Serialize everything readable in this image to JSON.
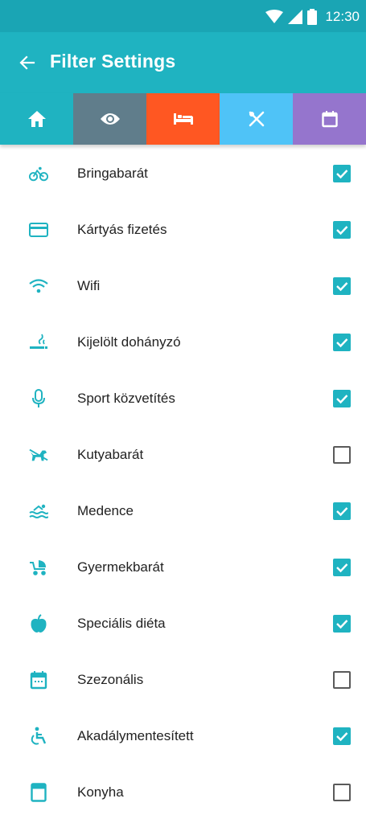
{
  "status_bar": {
    "time": "12:30"
  },
  "app_bar": {
    "title": "Filter Settings"
  },
  "colors": {
    "status": "#1aa5b4",
    "app_bar": "#1fb3c1",
    "accent": "#1fb3c1",
    "tab_home": "#1fb3c1",
    "tab_sights": "#607d8b",
    "tab_accommodation": "#ff5722",
    "tab_restaurants": "#4fc3f7",
    "tab_events": "#9575cd"
  },
  "tabs": [
    {
      "icon": "home-icon",
      "color": "#1fb3c1"
    },
    {
      "icon": "eye-icon",
      "color": "#607d8b"
    },
    {
      "icon": "bed-icon",
      "color": "#ff5722"
    },
    {
      "icon": "cutlery-icon",
      "color": "#4fc3f7"
    },
    {
      "icon": "calendar-icon",
      "color": "#9575cd"
    }
  ],
  "filters": [
    {
      "label": "Bringabarát",
      "icon": "bicycle-icon",
      "checked": true
    },
    {
      "label": "Kártyás fizetés",
      "icon": "credit-card-icon",
      "checked": true
    },
    {
      "label": "Wifi",
      "icon": "wifi-icon",
      "checked": true
    },
    {
      "label": "Kijelölt dohányzó",
      "icon": "smoking-icon",
      "checked": true
    },
    {
      "label": "Sport közvetítés",
      "icon": "microphone-icon",
      "checked": true
    },
    {
      "label": "Kutyabarát",
      "icon": "dog-icon",
      "checked": false
    },
    {
      "label": "Medence",
      "icon": "pool-icon",
      "checked": true
    },
    {
      "label": "Gyermekbarát",
      "icon": "stroller-icon",
      "checked": true
    },
    {
      "label": "Speciális diéta",
      "icon": "apple-icon",
      "checked": true
    },
    {
      "label": "Szezonális",
      "icon": "calendar-event-icon",
      "checked": false
    },
    {
      "label": "Akadálymentesített",
      "icon": "accessible-icon",
      "checked": true
    },
    {
      "label": "Konyha",
      "icon": "kitchen-icon",
      "checked": false
    }
  ]
}
